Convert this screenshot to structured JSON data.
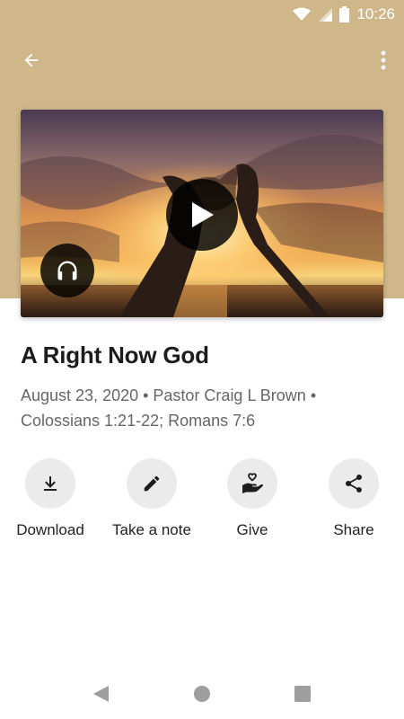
{
  "status_bar": {
    "time": "10:26",
    "icons": [
      "wifi-icon",
      "signal-icon",
      "battery-icon"
    ]
  },
  "app_bar": {
    "back_icon": "arrow-left-icon",
    "more_icon": "more-vertical-icon",
    "background_color": "#cfb78a"
  },
  "hero": {
    "play_icon": "play-icon",
    "audio_icon": "headphones-icon"
  },
  "sermon": {
    "title": "A Right Now God",
    "meta_line1": "August 23, 2020 • Pastor Craig L Brown •",
    "meta_line2": "Colossians 1:21-22; Romans 7:6"
  },
  "actions": [
    {
      "label": "Download",
      "icon": "download-icon"
    },
    {
      "label": "Take a note",
      "icon": "pencil-icon"
    },
    {
      "label": "Give",
      "icon": "give-heart-hand-icon"
    },
    {
      "label": "Share",
      "icon": "share-icon"
    }
  ],
  "nav_bar": {
    "icons": [
      "back-triangle-icon",
      "home-circle-icon",
      "recents-square-icon"
    ]
  }
}
